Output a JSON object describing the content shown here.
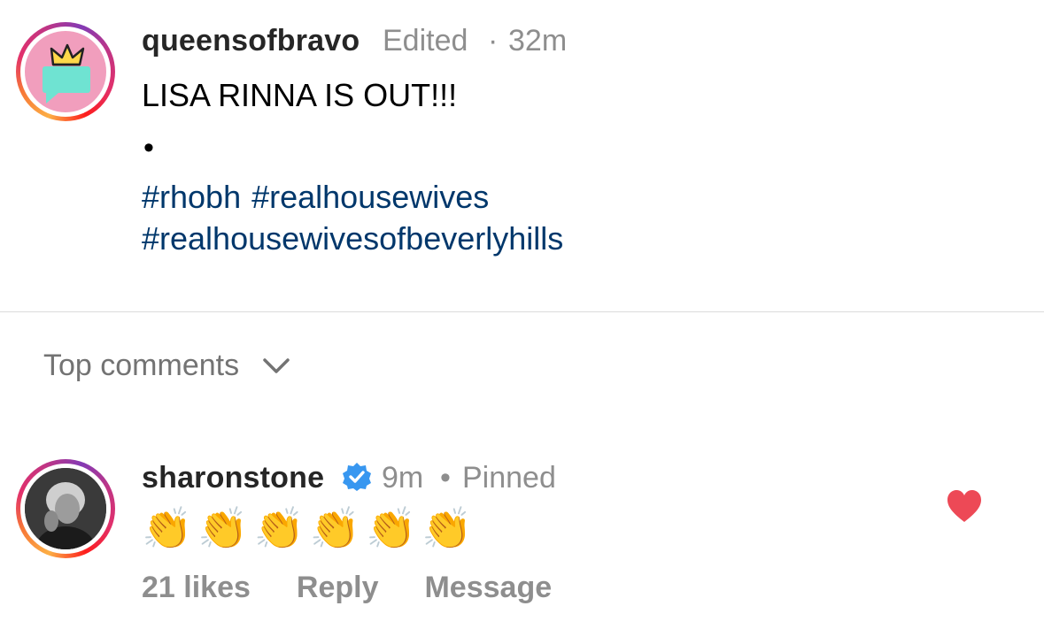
{
  "post": {
    "username": "queensofbravo",
    "edited": "Edited",
    "time": "32m",
    "caption": "LISA RINNA IS OUT!!!",
    "bullet": "•",
    "hashtags": [
      "#rhobh",
      "#realhousewives",
      "#realhousewivesofbeverlyhills"
    ]
  },
  "comments_header": {
    "label": "Top comments",
    "icon": "chevron-down-icon"
  },
  "comment": {
    "username": "sharonstone",
    "verified_icon": "verified-badge-icon",
    "time": "9m",
    "separator": "•",
    "pinned": "Pinned",
    "text": "👏👏👏👏👏👏",
    "likes": "21 likes",
    "reply": "Reply",
    "message": "Message",
    "liked": true
  },
  "colors": {
    "hashtag": "#00376b",
    "heart": "#ed4956",
    "verified": "#3897f0",
    "meta": "#8e8e8e"
  }
}
